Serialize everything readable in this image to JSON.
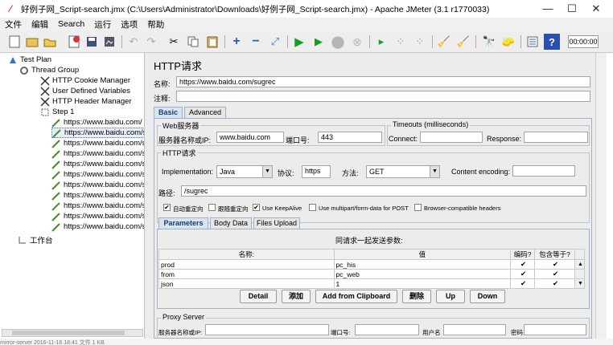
{
  "window": {
    "title": "好例子网_Script-search.jmx (C:\\Users\\Administrator\\Downloads\\好例子网_Script-search.jmx) - Apache JMeter (3.1 r1770033)",
    "minimize": "—",
    "maximize": "☐",
    "close": "✕"
  },
  "menu": [
    "文件",
    "编辑",
    "Search",
    "运行",
    "选项",
    "帮助"
  ],
  "toolbar": {
    "timer": "00:00:00"
  },
  "tree": {
    "items": [
      {
        "label": "Test Plan"
      },
      {
        "label": "Thread Group"
      },
      {
        "label": "HTTP Cookie Manager"
      },
      {
        "label": "User Defined Variables"
      },
      {
        "label": "HTTP Header Manager"
      },
      {
        "label": "Step 1"
      },
      {
        "label": "https://www.baidu.com/"
      },
      {
        "label": "https://www.baidu.com/s"
      },
      {
        "label": "https://www.baidu.com/s"
      },
      {
        "label": "https://www.baidu.com/s"
      },
      {
        "label": "https://www.baidu.com/s"
      },
      {
        "label": "https://www.baidu.com/s"
      },
      {
        "label": "https://www.baidu.com/s"
      },
      {
        "label": "https://www.baidu.com/s"
      },
      {
        "label": "https://www.baidu.com/s"
      },
      {
        "label": "https://www.baidu.com/s"
      },
      {
        "label": "https://www.baidu.com/s"
      },
      {
        "label": "工作台"
      }
    ]
  },
  "panel": {
    "heading": "HTTP请求",
    "name_label": "名称:",
    "name_value": "https://www.baidu.com/sugrec",
    "comment_label": "注释:",
    "comment_value": "",
    "tabs": [
      "Basic",
      "Advanced"
    ],
    "web_server": {
      "title": "Web服务器",
      "server_label": "服务器名称或IP:",
      "server_value": "www.baidu.com",
      "port_label": "端口号:",
      "port_value": "443"
    },
    "timeouts": {
      "title": "Timeouts (milliseconds)",
      "connect_label": "Connect:",
      "connect_value": "",
      "response_label": "Response:",
      "response_value": ""
    },
    "http_request": {
      "title": "HTTP请求",
      "impl_label": "Implementation:",
      "impl_value": "Java",
      "protocol_label": "协议:",
      "protocol_value": "https",
      "method_label": "方法:",
      "method_value": "GET",
      "encoding_label": "Content encoding:",
      "encoding_value": "",
      "path_label": "路径:",
      "path_value": "/sugrec"
    },
    "checkboxes": [
      {
        "label": "自动重定向",
        "checked": true
      },
      {
        "label": "跟随重定向",
        "checked": false
      },
      {
        "label": "Use KeepAlive",
        "checked": true
      },
      {
        "label": "Use multipart/form-data for POST",
        "checked": false
      },
      {
        "label": "Browser-compatible headers",
        "checked": false
      }
    ],
    "subtabs": [
      "Parameters",
      "Body Data",
      "Files Upload"
    ],
    "params": {
      "title": "同请求一起发送参数:",
      "col_name": "名称:",
      "col_value": "值",
      "col_encode": "编码?",
      "col_include": "包含等于?",
      "rows": [
        {
          "name": "prod",
          "value": "pc_his",
          "encode": "✔",
          "include": "✔"
        },
        {
          "name": "from",
          "value": "pc_web",
          "encode": "✔",
          "include": "✔"
        },
        {
          "name": "json",
          "value": "1",
          "encode": "✔",
          "include": "✔"
        }
      ]
    },
    "buttons": [
      "Detail",
      "添加",
      "Add from Clipboard",
      "删除",
      "Up",
      "Down"
    ],
    "proxy": {
      "title": "Proxy Server",
      "server_label": "服务器名称或IP:",
      "port_label": "端口号:",
      "user_label": "用户名",
      "pass_label": "密码"
    }
  },
  "background_strip": "mirror-server      2016-11-16 18:41    文件     1 KB"
}
